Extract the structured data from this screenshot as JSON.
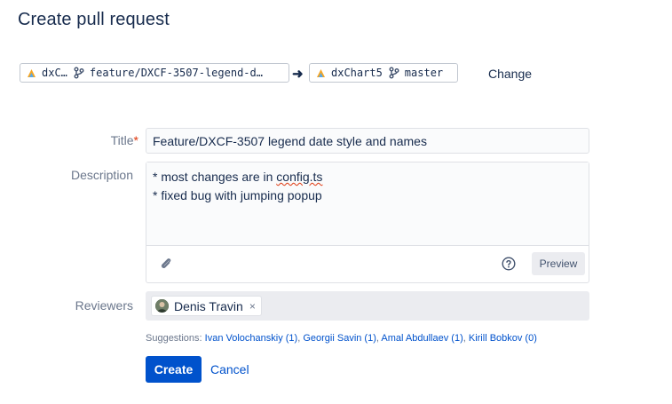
{
  "page": {
    "title": "Create pull request"
  },
  "source": {
    "repo": "dxC…",
    "branch": "feature/DXCF-3507-legend-d…"
  },
  "destination": {
    "repo": "dxChart5",
    "branch": "master"
  },
  "change_label": "Change",
  "form": {
    "title_label": "Title",
    "title_required_mark": "*",
    "title_value": "Feature/DXCF-3507 legend date style and names",
    "description_label": "Description",
    "description_line1_prefix": "* most changes are in ",
    "description_line1_word": "config.ts",
    "description_line2": "* fixed bug with jumping popup",
    "preview_label": "Preview",
    "reviewers_label": "Reviewers",
    "reviewer_name": "Denis Travin",
    "reviewer_remove": "×"
  },
  "suggestions": {
    "prefix": "Suggestions: ",
    "people": [
      "Ivan Volochanskiy (1)",
      "Georgii Savin (1)",
      "Amal Abdullaev (1)",
      "Kirill Bobkov (0)"
    ]
  },
  "actions": {
    "create_label": "Create",
    "cancel_label": "Cancel"
  },
  "colors": {
    "primary": "#0052cc",
    "text": "#172b4d",
    "muted": "#6b778c",
    "required": "#de350b"
  },
  "icons": [
    "repo-avatar-icon",
    "branch-icon",
    "arrow-right-icon",
    "attachment-icon",
    "help-icon",
    "avatar"
  ]
}
